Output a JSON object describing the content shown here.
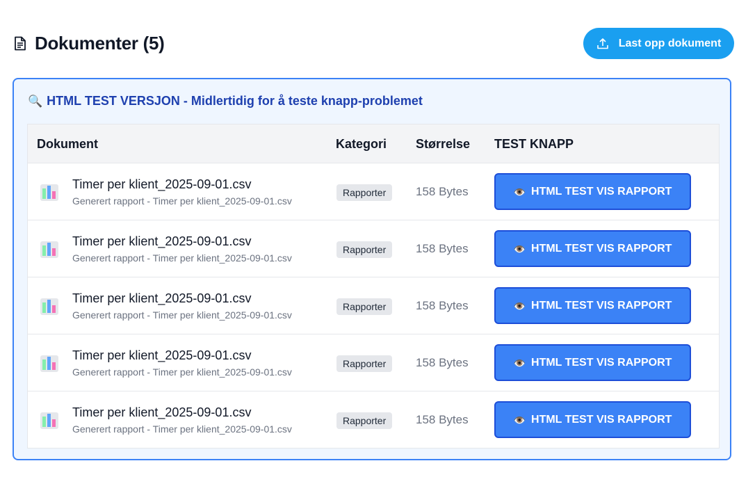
{
  "header": {
    "title": "Dokumenter (5)",
    "title_icon": "document-icon",
    "upload_button": {
      "label": "Last opp dokument",
      "icon": "upload-icon"
    }
  },
  "test_card": {
    "heading_icon": "🔍",
    "heading": "HTML TEST VERSJON - Midlertidig for å teste knapp-problemet",
    "columns": [
      "Dokument",
      "Kategori",
      "Størrelse",
      "TEST KNAPP"
    ],
    "rows": [
      {
        "icon": "bar-chart-icon",
        "name": "Timer per klient_2025-09-01.csv",
        "description": "Generert rapport - Timer per klient_2025-09-01.csv",
        "category": "Rapporter",
        "size": "158 Bytes",
        "button_icon": "👁️",
        "button_label": "HTML TEST VIS RAPPORT"
      },
      {
        "icon": "bar-chart-icon",
        "name": "Timer per klient_2025-09-01.csv",
        "description": "Generert rapport - Timer per klient_2025-09-01.csv",
        "category": "Rapporter",
        "size": "158 Bytes",
        "button_icon": "👁️",
        "button_label": "HTML TEST VIS RAPPORT"
      },
      {
        "icon": "bar-chart-icon",
        "name": "Timer per klient_2025-09-01.csv",
        "description": "Generert rapport - Timer per klient_2025-09-01.csv",
        "category": "Rapporter",
        "size": "158 Bytes",
        "button_icon": "👁️",
        "button_label": "HTML TEST VIS RAPPORT"
      },
      {
        "icon": "bar-chart-icon",
        "name": "Timer per klient_2025-09-01.csv",
        "description": "Generert rapport - Timer per klient_2025-09-01.csv",
        "category": "Rapporter",
        "size": "158 Bytes",
        "button_icon": "👁️",
        "button_label": "HTML TEST VIS RAPPORT"
      },
      {
        "icon": "bar-chart-icon",
        "name": "Timer per klient_2025-09-01.csv",
        "description": "Generert rapport - Timer per klient_2025-09-01.csv",
        "category": "Rapporter",
        "size": "158 Bytes",
        "button_icon": "👁️",
        "button_label": "HTML TEST VIS RAPPORT"
      }
    ]
  },
  "colors": {
    "upload_button_bg": "#1a9ff0",
    "card_border": "#3b82f6",
    "card_bg": "#eff6ff",
    "heading_text": "#1e40af",
    "test_button_bg": "#3b82f6",
    "test_button_border": "#1d4ed8"
  }
}
